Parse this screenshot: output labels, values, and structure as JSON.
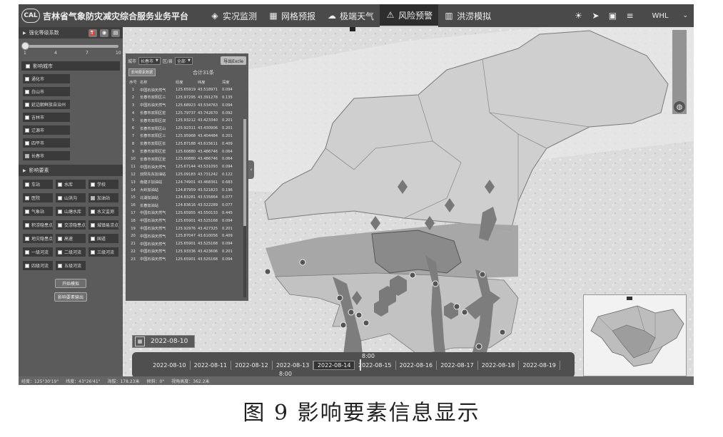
{
  "header": {
    "logo_text": "CAL",
    "title": "吉林省气象防灾减灾综合服务业务平台",
    "nav": [
      {
        "label": "实况监测",
        "icon": "monitor-icon"
      },
      {
        "label": "网格预报",
        "icon": "grid-icon"
      },
      {
        "label": "极端天气",
        "icon": "cloud-icon"
      },
      {
        "label": "风险预警",
        "icon": "warning-icon"
      },
      {
        "label": "洪涝模拟",
        "icon": "flood-icon"
      }
    ],
    "active_nav": "风险预警",
    "tools": [
      "sun-icon",
      "send-icon",
      "computer-icon",
      "database-icon"
    ],
    "user": "WHL"
  },
  "left_panel": {
    "slider_title": "强化等级系数",
    "slider_ticks": [
      "1",
      "4",
      "7",
      "10"
    ],
    "slider_value": 1,
    "cities_title": "影响城市",
    "cities": [
      {
        "label": "通化市",
        "checked": false
      },
      {
        "label": "白山市",
        "checked": false
      },
      {
        "label": "延边朝鲜族自治州",
        "checked": false
      },
      {
        "label": "吉林市",
        "checked": false
      },
      {
        "label": "辽源市",
        "checked": false
      },
      {
        "label": "四平市",
        "checked": false
      },
      {
        "label": "长春市",
        "checked": true
      }
    ],
    "factors_title": "影响要素",
    "factors": [
      {
        "label": "车站",
        "checked": false
      },
      {
        "label": "水库",
        "checked": false
      },
      {
        "label": "学校",
        "checked": false
      },
      {
        "label": "医院",
        "checked": false
      },
      {
        "label": "山洪沟",
        "checked": false
      },
      {
        "label": "加油站",
        "checked": true
      },
      {
        "label": "气象站",
        "checked": false
      },
      {
        "label": "山塘水库",
        "checked": false
      },
      {
        "label": "水文监测",
        "checked": false
      },
      {
        "label": "积涝隐患点",
        "checked": false
      },
      {
        "label": "交涝隐患点",
        "checked": false
      },
      {
        "label": "城镇易涝点",
        "checked": false
      },
      {
        "label": "地灾隐患点",
        "checked": false
      },
      {
        "label": "高速",
        "checked": false
      },
      {
        "label": "国道",
        "checked": false
      },
      {
        "label": "一级河流",
        "checked": false
      },
      {
        "label": "二级河流",
        "checked": false
      },
      {
        "label": "三级河流",
        "checked": false
      },
      {
        "label": "四级河流",
        "checked": false
      },
      {
        "label": "五级河流",
        "checked": false
      }
    ],
    "start_button": "开始模拟",
    "export_button": "影响要素输出"
  },
  "table_panel": {
    "city_label": "城市",
    "city_value": "长春市",
    "district_label": "区/县",
    "district_value": "全部",
    "export_button": "导出Excle",
    "info_button": "影响要素数据",
    "total": "合计31条",
    "columns": [
      "序号",
      "名称",
      "经度",
      "纬度",
      "深度"
    ],
    "rows": [
      [
        "1",
        "中国石油天然气",
        "125.65919",
        "43.518971",
        "0.094"
      ],
      [
        "2",
        "长春市双阳区三",
        "125.97295",
        "43.391278",
        "0.135"
      ],
      [
        "3",
        "中国石油天然气",
        "125.68923",
        "43.534763",
        "0.094"
      ],
      [
        "4",
        "长春市双阳区宏",
        "125.79737",
        "43.742670",
        "0.092"
      ],
      [
        "5",
        "长春市双阳区双",
        "125.93212",
        "43.423340",
        "0.201"
      ],
      [
        "6",
        "长春市双阳区山",
        "125.92311",
        "43.430906",
        "0.201"
      ],
      [
        "7",
        "长春市双阳区三",
        "125.95968",
        "43.404484",
        "0.201"
      ],
      [
        "8",
        "长春市双阳区长",
        "125.87188",
        "43.615611",
        "0.409"
      ],
      [
        "9",
        "长春市双阳区宏",
        "125.60880",
        "43.486746",
        "0.064"
      ],
      [
        "10",
        "长春市双阳区宏",
        "125.60880",
        "43.486746",
        "0.064"
      ],
      [
        "11",
        "中国石油天然气",
        "125.67144",
        "43.531093",
        "0.094"
      ],
      [
        "12",
        "双阳先东加油站",
        "125.09183",
        "43.731242",
        "0.122"
      ],
      [
        "13",
        "南建子加油站",
        "124.74901",
        "43.468361",
        "0.683"
      ],
      [
        "14",
        "大岭加油站",
        "124.87959",
        "43.521823",
        "0.196"
      ],
      [
        "15",
        "北湖加油站",
        "124.83281",
        "43.535864",
        "0.077"
      ],
      [
        "16",
        "长春加油站",
        "124.83616",
        "43.522289",
        "0.077"
      ],
      [
        "17",
        "中国石油天然气",
        "125.65955",
        "43.550133",
        "0.445"
      ],
      [
        "18",
        "中国石油天然气",
        "125.65901",
        "43.525168",
        "0.094"
      ],
      [
        "19",
        "中国石油天然气",
        "125.92976",
        "43.427325",
        "0.201"
      ],
      [
        "20",
        "中国石油天然气",
        "125.87047",
        "43.610056",
        "0.409"
      ],
      [
        "21",
        "中国石油天然气",
        "125.65901",
        "43.525168",
        "0.094"
      ],
      [
        "22",
        "中国石油天然气",
        "125.93336",
        "43.423606",
        "0.201"
      ],
      [
        "23",
        "中国石油天然气",
        "125.65901",
        "43.525168",
        "0.094"
      ]
    ]
  },
  "timeline": {
    "current_date": "2022-08-10",
    "time_top": "8:00",
    "time_bottom": "8:00",
    "dates": [
      "2022-08-10",
      "2022-08-11",
      "2022-08-12",
      "2022-08-13",
      "2022-08-14",
      "2022-08-15",
      "2022-08-16",
      "2022-08-17",
      "2022-08-18",
      "2022-08-19"
    ],
    "selected_date": "2022-08-14"
  },
  "status_bar": {
    "lon": "经度：125°30'19\"",
    "lat": "纬度：43°26'41\"",
    "alt": "海拔：178.23米",
    "angle": "倾斜：0°",
    "view": "视角高度：362.2米"
  },
  "caption": "图 9    影响要素信息显示",
  "colors": {
    "topbar": "#4a4a4a",
    "panel": "#5b5b5b",
    "map_bg": "#d9d9d9",
    "risk_band": "#a3a3a3",
    "risk_core": "#888888"
  }
}
